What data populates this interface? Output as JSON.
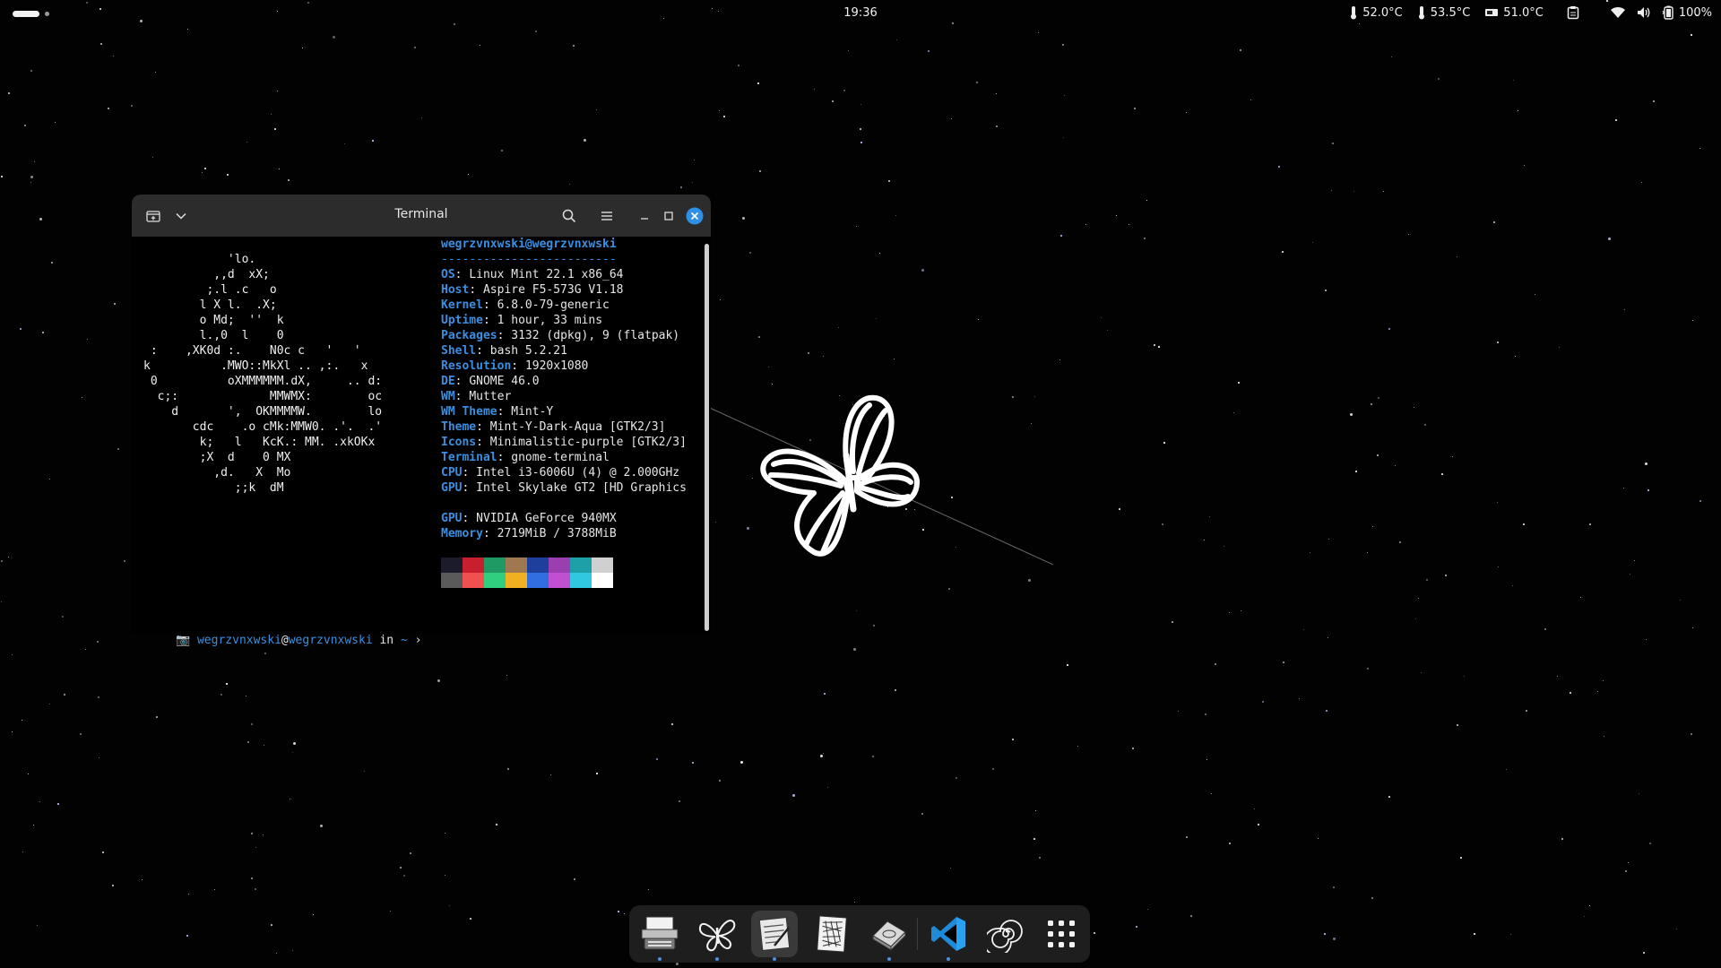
{
  "topbar": {
    "clock": "19:36",
    "temps": [
      {
        "icon": "thermometer-icon",
        "value": "52.0°C"
      },
      {
        "icon": "thermometer-icon",
        "value": "53.5°C"
      },
      {
        "icon": "gpu-card-icon",
        "value": "51.0°C"
      }
    ],
    "battery": "100%",
    "tray_icons": [
      "clipboard-icon",
      "wifi-icon",
      "volume-icon",
      "battery-icon"
    ]
  },
  "terminal": {
    "title": "Terminal",
    "ascii_art": "            'lo.\n          ,,d  xX;\n         ;.l .c   o\n        l X l.  .X;\n        o Md;  ''  k\n        l.,0  l    0\n :    ,XK0d :.    N0c c   '   '\nk          .MWO::MkXl .. ,:.   x\n 0          oXMMMMMM.dX,     .. d:\n  c;:             MMWMX:        oc\n    d       ',  OKMMMMW.        lo\n       cdc    .o cMk:MMW0. .'.  .'\n        k;   l   KcK.: MM. .xkOKx\n        ;X  d    0 MX\n          ,d.   X  Mo\n             ;;k  dM",
    "user_host": "wegrzvnxwski@wegrzvnxwski",
    "separator": "-------------------------",
    "info": [
      {
        "key": "OS",
        "value": "Linux Mint 22.1 x86_64"
      },
      {
        "key": "Host",
        "value": "Aspire F5-573G V1.18"
      },
      {
        "key": "Kernel",
        "value": "6.8.0-79-generic"
      },
      {
        "key": "Uptime",
        "value": "1 hour, 33 mins"
      },
      {
        "key": "Packages",
        "value": "3132 (dpkg), 9 (flatpak)"
      },
      {
        "key": "Shell",
        "value": "bash 5.2.21"
      },
      {
        "key": "Resolution",
        "value": "1920x1080"
      },
      {
        "key": "DE",
        "value": "GNOME 46.0"
      },
      {
        "key": "WM",
        "value": "Mutter"
      },
      {
        "key": "WM Theme",
        "value": "Mint-Y"
      },
      {
        "key": "Theme",
        "value": "Mint-Y-Dark-Aqua [GTK2/3]"
      },
      {
        "key": "Icons",
        "value": "Minimalistic-purple [GTK2/3]"
      },
      {
        "key": "Terminal",
        "value": "gnome-terminal"
      },
      {
        "key": "CPU",
        "value": "Intel i3-6006U (4) @ 2.000GHz"
      },
      {
        "key": "GPU",
        "value": "Intel Skylake GT2 [HD Graphics"
      },
      {
        "key": "",
        "value": ""
      },
      {
        "key": "GPU",
        "value": "NVIDIA GeForce 940MX"
      },
      {
        "key": "Memory",
        "value": "2719MiB / 3788MiB"
      }
    ],
    "palette_top": [
      "#1b1b2b",
      "#c81f2f",
      "#1f9a64",
      "#a07850",
      "#1e3f9c",
      "#9b3eb0",
      "#1ea0a8",
      "#d0d0d0"
    ],
    "palette_bottom": [
      "#5a5a5a",
      "#f05050",
      "#2fcf7f",
      "#f0b020",
      "#2f6fe0",
      "#c050d0",
      "#30c8e0",
      "#ffffff"
    ],
    "prompt": {
      "icon": "camera-icon",
      "user": "wegrzvnxwski",
      "at": "@",
      "host": "wegrzvnxwski",
      "in": "in",
      "dir": "~",
      "arrow": "›"
    }
  },
  "dock": {
    "items": [
      {
        "name": "dock-app-typewriter",
        "icon": "typewriter-icon",
        "running": true,
        "active": false
      },
      {
        "name": "dock-app-butterfly",
        "icon": "butterfly-icon",
        "running": true,
        "active": false
      },
      {
        "name": "dock-app-terminal",
        "icon": "notepad-icon",
        "running": true,
        "active": true
      },
      {
        "name": "dock-app-sketch",
        "icon": "sketch-pad-icon",
        "running": false,
        "active": false
      },
      {
        "name": "dock-app-drive",
        "icon": "disk-icon",
        "running": true,
        "active": false
      },
      {
        "name": "dock-app-vscode",
        "icon": "vscode-icon",
        "running": true,
        "active": false
      },
      {
        "name": "dock-app-spiral",
        "icon": "spiral-icon",
        "running": false,
        "active": false
      },
      {
        "name": "dock-app-grid",
        "icon": "app-grid-icon",
        "running": false,
        "active": false
      }
    ]
  }
}
